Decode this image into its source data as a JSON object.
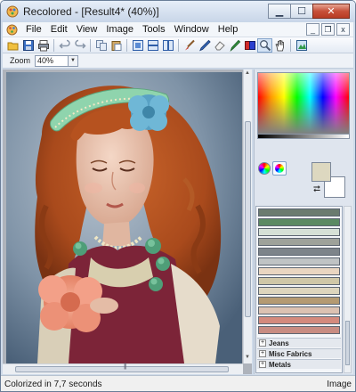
{
  "window": {
    "title": "Recolored - [Result4* (40%)]",
    "controls": {
      "minimize": "▁",
      "maximize": "☐",
      "close": "✕"
    }
  },
  "menu": {
    "items": [
      "File",
      "Edit",
      "View",
      "Image",
      "Tools",
      "Window",
      "Help"
    ],
    "mdi_controls": {
      "minimize": "_",
      "restore": "❐",
      "close": "x"
    }
  },
  "toolbar": {
    "buttons": [
      {
        "icon": "open-folder-icon"
      },
      {
        "icon": "save-icon"
      },
      {
        "icon": "print-icon"
      },
      {
        "icon": "undo-icon"
      },
      {
        "icon": "redo-icon"
      },
      {
        "icon": "copy-icon"
      },
      {
        "icon": "paste-icon"
      },
      {
        "icon": "view-single-icon"
      },
      {
        "icon": "view-split-horizontal-icon"
      },
      {
        "icon": "view-split-vertical-icon"
      },
      {
        "icon": "brush-icon"
      },
      {
        "icon": "pen-icon"
      },
      {
        "icon": "eraser-icon"
      },
      {
        "icon": "eyedropper-icon"
      },
      {
        "icon": "color-fill-icon"
      },
      {
        "icon": "zoom-icon"
      },
      {
        "icon": "hand-icon"
      },
      {
        "icon": "navigator-icon"
      }
    ]
  },
  "zoom": {
    "label": "Zoom",
    "value": "40%",
    "dropdown_glyph": "▼"
  },
  "canvas": {
    "vscroll_up": "▲",
    "vscroll_down": "▼",
    "hscroll_grip": "|||"
  },
  "colors": {
    "foreground": "#ddd8c0",
    "background": "#ffffff",
    "swap_glyph": "⮂"
  },
  "palette": {
    "swatches": [
      "#6b7b6f",
      "#5b8a62",
      "#d6e1d6",
      "#9ea29a",
      "#7d848a",
      "#bfc3c4",
      "#e9d6c1",
      "#cfc7a7",
      "#ddd5bd",
      "#b49a72",
      "#dcc2b2",
      "#d48a7d",
      "#c88c82"
    ],
    "groups": [
      {
        "label": "Jeans",
        "toggle": "+"
      },
      {
        "label": "Misc Fabrics",
        "toggle": "+"
      },
      {
        "label": "Metals",
        "toggle": "+"
      }
    ]
  },
  "status": {
    "message": "Colorized in 7,7 seconds",
    "right": "Image"
  }
}
